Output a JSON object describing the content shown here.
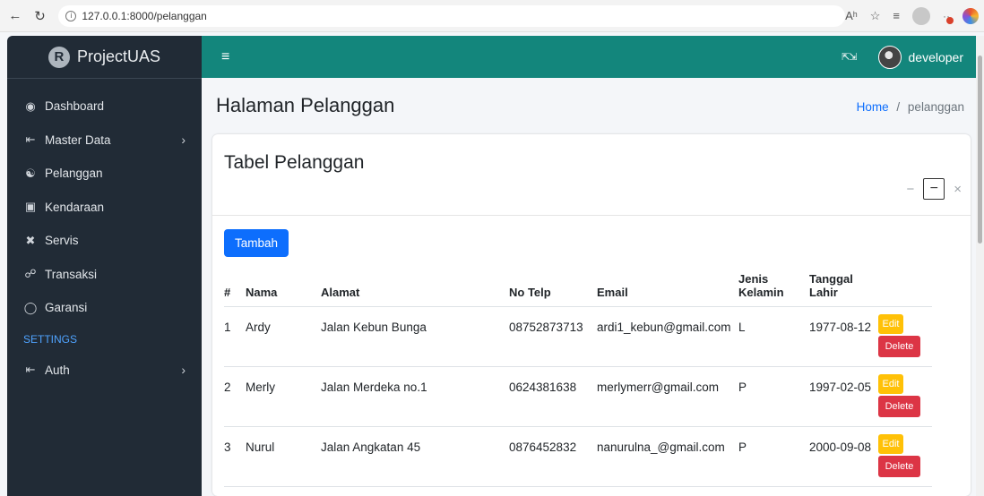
{
  "browser": {
    "url": "127.0.0.1:8000/pelanggan",
    "read_aloud": "Aʰ"
  },
  "sidebar": {
    "brand": "ProjectUAS",
    "items": [
      {
        "label": "Dashboard",
        "icon": "dashboard-icon"
      },
      {
        "label": "Master Data",
        "icon": "login-icon",
        "expandable": true
      },
      {
        "label": "Pelanggan",
        "icon": "users-icon"
      },
      {
        "label": "Kendaraan",
        "icon": "car-icon"
      },
      {
        "label": "Servis",
        "icon": "tools-icon"
      },
      {
        "label": "Transaksi",
        "icon": "cart-icon"
      },
      {
        "label": "Garansi",
        "icon": "shield-icon"
      }
    ],
    "settings_header": "SETTINGS",
    "settings_items": [
      {
        "label": "Auth",
        "icon": "login-icon",
        "expandable": true
      }
    ]
  },
  "navbar": {
    "username": "developer",
    "accent_color": "#13867c"
  },
  "page": {
    "title": "Halaman Pelanggan",
    "breadcrumb_home": "Home",
    "breadcrumb_sep": "/",
    "breadcrumb_current": "pelanggan"
  },
  "card": {
    "title": "Tabel Pelanggan",
    "add_label": "Tambah",
    "tool_minimize": "−",
    "tool_box": "−",
    "tool_close": "×",
    "columns": [
      "#",
      "Nama",
      "Alamat",
      "No Telp",
      "Email",
      "Jenis Kelamin",
      "Tanggal Lahir",
      ""
    ],
    "rows": [
      {
        "no": "1",
        "nama": "Ardy",
        "alamat": "Jalan Kebun Bunga",
        "telp": "08752873713",
        "email": "ardi1_kebun@gmail.com",
        "jk": "L",
        "lahir": "1977-08-12"
      },
      {
        "no": "2",
        "nama": "Merly",
        "alamat": "Jalan Merdeka no.1",
        "telp": "0624381638",
        "email": "merlymerr@gmail.com",
        "jk": "P",
        "lahir": "1997-02-05"
      },
      {
        "no": "3",
        "nama": "Nurul",
        "alamat": "Jalan Angkatan 45",
        "telp": "0876452832",
        "email": "nanurulna_@gmail.com",
        "jk": "P",
        "lahir": "2000-09-08"
      }
    ],
    "edit_label": "Edit",
    "delete_label": "Delete"
  }
}
